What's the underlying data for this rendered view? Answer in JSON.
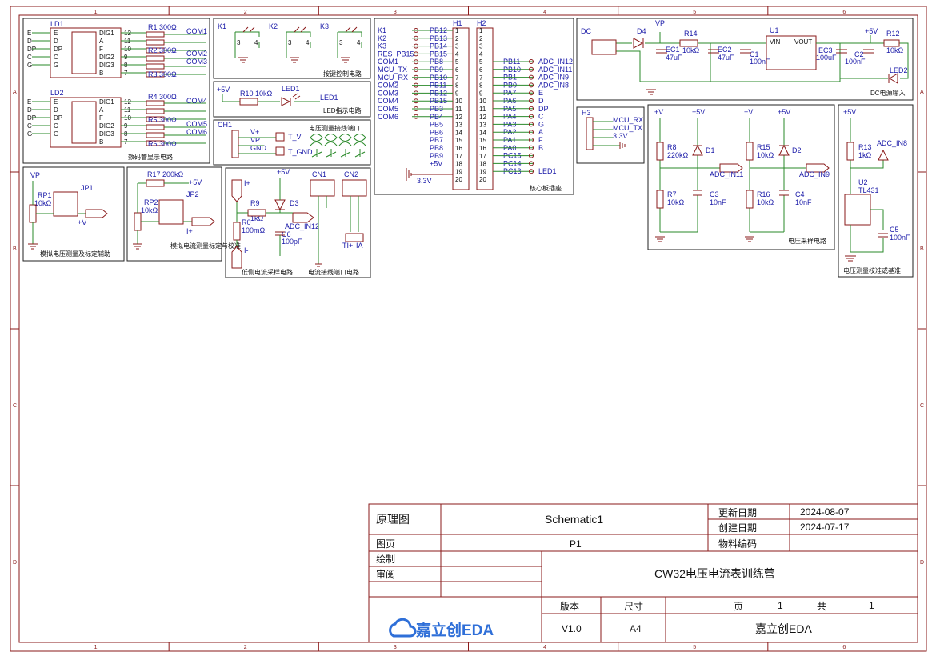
{
  "border": {
    "cols": [
      "1",
      "2",
      "3",
      "4",
      "5",
      "6"
    ],
    "rows": [
      "A",
      "B",
      "C",
      "D"
    ]
  },
  "blocks": {
    "seg": "数码管显示电路",
    "keys": "按键控制电路",
    "led": "LED指示电路",
    "vport": "电压测量接线端口",
    "core": "核心板插座",
    "dc": "DC电源输入",
    "vsample": "电压采样电路",
    "vcal": "电压测量校准或基准",
    "vaux": "模拟电压测量及标定辅助",
    "iaux": "模拟电流测量标定与校准",
    "isample": "低侧电流采样电路",
    "iport": "电流接线端口电路"
  },
  "labels": {
    "ld1": "LD1",
    "ld2": "LD2",
    "r1": "R1 300Ω",
    "r2": "R2 300Ω",
    "r3": "R3 300Ω",
    "r4": "R4 300Ω",
    "r5": "R5 300Ω",
    "r6": "R6 300Ω",
    "com1": "COM1",
    "com2": "COM2",
    "com3": "COM3",
    "com4": "COM4",
    "com5": "COM5",
    "com6": "COM6",
    "k1": "K1",
    "k2": "K2",
    "k3": "K3",
    "led1": "LED1",
    "r10": "R10 10kΩ",
    "p5v": "+5V",
    "ch1": "CH1",
    "vplus": "V+",
    "vp": "VP",
    "gnd": "GND",
    "tv": "T_V",
    "tgnd": "T_GND",
    "h1": "H1",
    "h2": "H2",
    "h3": "H3",
    "p33": "3.3V",
    "dc_label": "DC",
    "d4": "D4",
    "r14": "R14",
    "r14v": "10kΩ",
    "ec1": "EC1",
    "ec1v": "47uF",
    "ec2": "EC2",
    "ec2v": "47uF",
    "c1": "C1",
    "c1v": "100nF",
    "u1": "U1",
    "vin": "VIN",
    "vout": "VOUT",
    "ec3": "EC3",
    "ec3v": "100uF",
    "c2": "C2",
    "c2v": "100nF",
    "r12": "R12",
    "r12v": "10kΩ",
    "led2": "LED2",
    "pv": "+V",
    "r8": "R8",
    "r8v": "220kΩ",
    "d1": "D1",
    "adc11": "ADC_IN11",
    "r7": "R7",
    "r7v": "10kΩ",
    "c3": "C3",
    "c3v": "10nF",
    "r15": "R15",
    "r15v": "10kΩ",
    "d2": "D2",
    "adc9": "ADC_IN9",
    "r16": "R16",
    "r16v": "10kΩ",
    "c4": "C4",
    "c4v": "10nF",
    "r13": "R13",
    "r13v": "1kΩ",
    "adc8": "ADC_IN8",
    "u2": "U2",
    "tl431": "TL431",
    "c5": "C5",
    "c5v": "100nF",
    "rp1": "RP1",
    "rp1v": "10kΩ",
    "jp1": "JP1",
    "r17": "R17 200kΩ",
    "rp2": "RP2",
    "rp2v": "10kΩ",
    "jp2": "JP2",
    "iplus": "I+",
    "iminus": "I-",
    "r9": "R9",
    "r9v": "1kΩ",
    "r0": "R0",
    "r0v": "100mΩ",
    "d3": "D3",
    "adc12": "ADC_IN12",
    "c6": "C6",
    "c6v": "100pF",
    "cn1": "CN1",
    "cn2": "CN2",
    "tiplus": "TI+",
    "ia": "IA",
    "mcurx": "MCU_RX",
    "mcutx": "MCU_TX",
    "v33": "3.3V"
  },
  "h1_left": [
    "K1",
    "K2",
    "K3",
    "RES_PB15",
    "COM1",
    "MCU_TX",
    "MCU_RX",
    "COM2",
    "COM3",
    "COM4",
    "COM5",
    "COM6"
  ],
  "h1_pins": [
    "PB12",
    "PB13",
    "PB14",
    "PB15",
    "PB8",
    "PB9",
    "PB10",
    "PB11",
    "PB12",
    "PB15",
    "PB3",
    "PB4",
    "PB5",
    "PB6",
    "PB7",
    "PB8",
    "PB9",
    "+5V"
  ],
  "h2_right": [
    "PB11",
    "PB10",
    "PB1",
    "PB0",
    "PA7",
    "PA6",
    "PA5",
    "PA4",
    "PA3",
    "PA2",
    "PA1",
    "PA0",
    "PC15",
    "PC14",
    "PC13"
  ],
  "h2_nets": [
    "ADC_IN12",
    "ADC_IN11",
    "ADC_IN9",
    "ADC_IN8",
    "E",
    "D",
    "DP",
    "C",
    "G",
    "A",
    "F",
    "B",
    "",
    "",
    "LED1"
  ],
  "seg_left": [
    "E",
    "D",
    "DP",
    "C",
    "G"
  ],
  "seg_right": [
    "DIG1",
    "A",
    "F",
    "DIG2",
    "DIG3",
    "B"
  ],
  "seg_pins": [
    "12",
    "11",
    "10",
    "9",
    "8",
    "7"
  ],
  "title_block": {
    "h_schematic": "原理图",
    "schematic_name": "Schematic1",
    "h_updated": "更新日期",
    "updated": "2024-08-07",
    "h_created": "创建日期",
    "created": "2024-07-17",
    "h_page": "图页",
    "page": "P1",
    "h_material": "物料编码",
    "material": "",
    "h_drawn": "绘制",
    "h_review": "审阅",
    "project": "CW32电压电流表训练营",
    "h_version": "版本",
    "h_size": "尺寸",
    "h_pg": "页",
    "pg": "1",
    "h_total": "共",
    "total": "1",
    "version": "V1.0",
    "size": "A4",
    "company": "嘉立创EDA",
    "logo": "嘉立创EDA"
  }
}
